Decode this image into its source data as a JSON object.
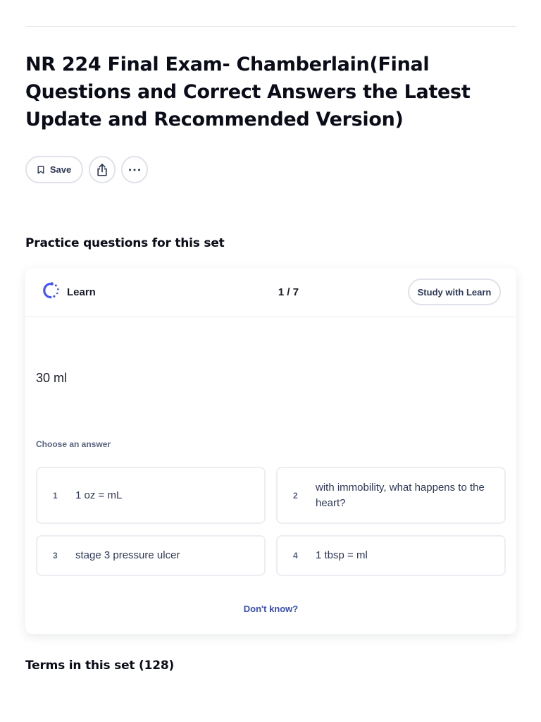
{
  "set": {
    "title": "NR 224 Final Exam- Chamberlain(Final Questions and Correct Answers the Latest Update and Recommended Version)"
  },
  "actions": {
    "save_label": "Save",
    "save_icon": "bookmark-icon",
    "share_icon": "share-icon",
    "more_icon": "more-icon"
  },
  "practice": {
    "heading": "Practice questions for this set",
    "mode_label": "Learn",
    "mode_icon": "learn-icon",
    "progress": "1 / 7",
    "study_button": "Study with Learn",
    "prompt": "30 ml",
    "choose_label": "Choose an answer",
    "options": [
      {
        "number": "1",
        "text": "1 oz = mL"
      },
      {
        "number": "2",
        "text": "with immobility, what happens to the heart?"
      },
      {
        "number": "3",
        "text": "stage 3 pressure ulcer"
      },
      {
        "number": "4",
        "text": "1 tbsp = ml"
      }
    ],
    "dont_know": "Don't know?"
  },
  "terms": {
    "heading": "Terms in this set (128)"
  },
  "colors": {
    "accent_blue": "#4255ff",
    "link_blue": "#3a4fb3",
    "text_dark": "#0a0d18",
    "muted": "#586380"
  }
}
